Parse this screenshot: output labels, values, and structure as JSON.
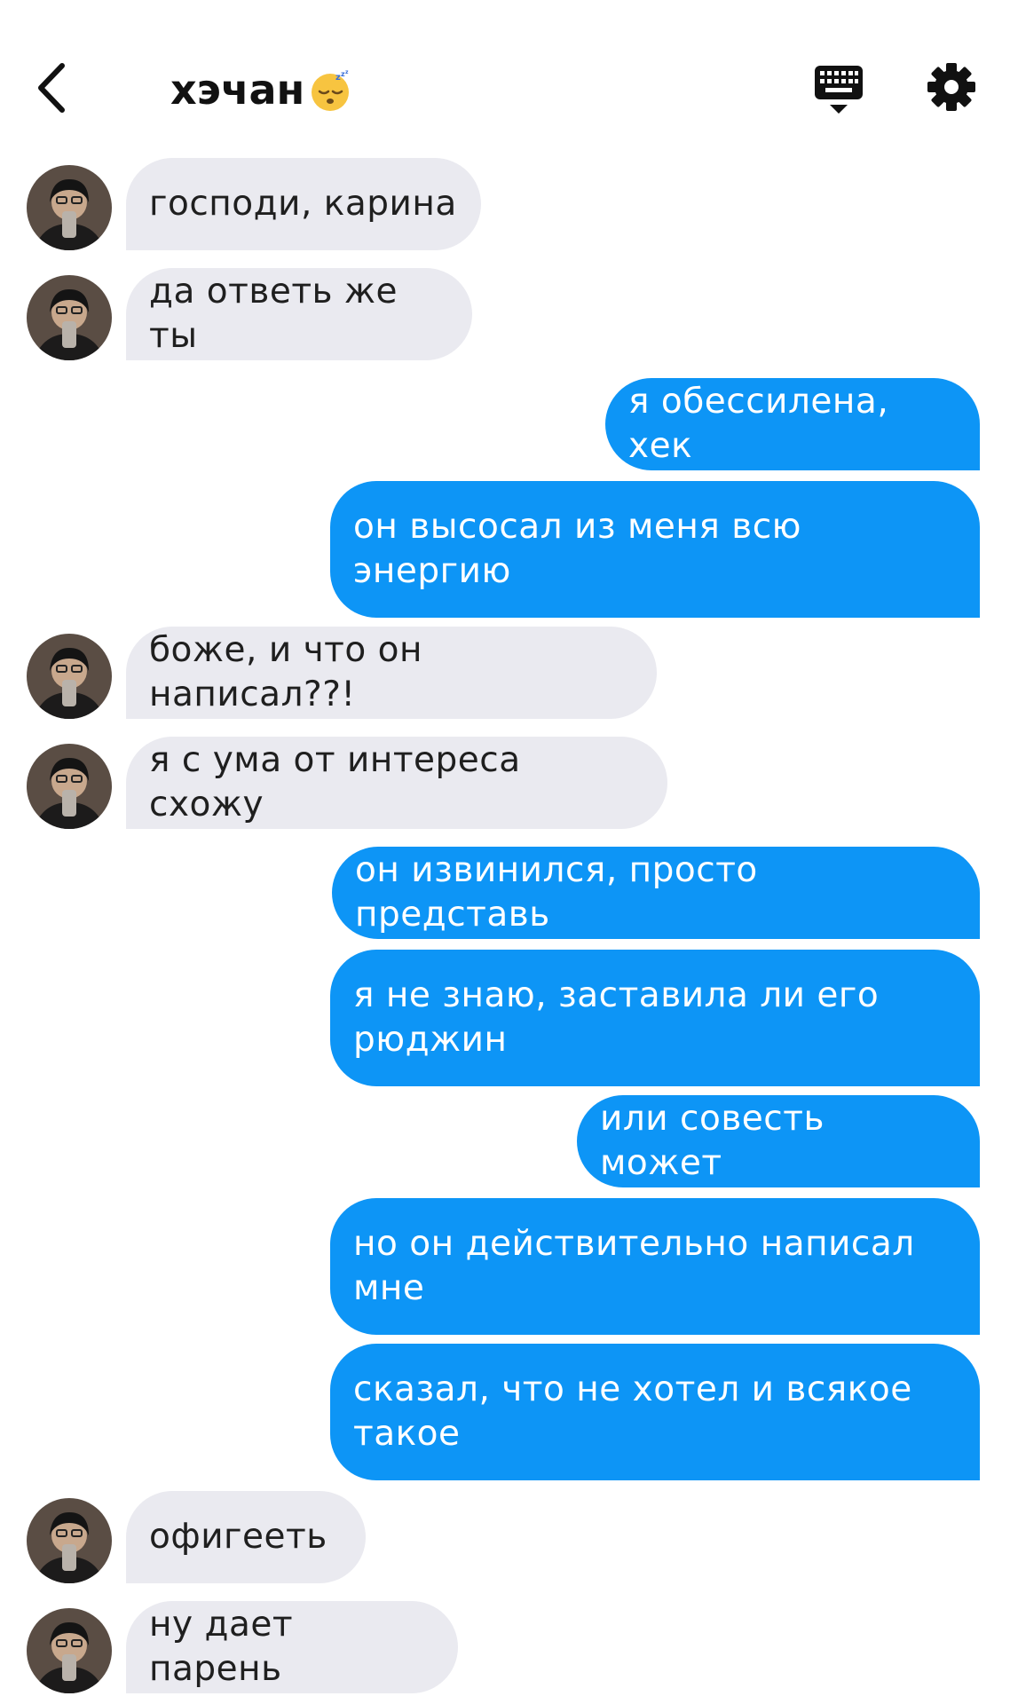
{
  "header": {
    "title": "хэчан",
    "status_emoji": "sleeping-face-emoji",
    "back_icon": "chevron-left-icon",
    "keyboard_icon": "keyboard-icon",
    "settings_icon": "gear-icon"
  },
  "colors": {
    "outgoing_bubble": "#0d95f6",
    "incoming_bubble": "#eaeaf0",
    "background": "#ffffff"
  },
  "messages": [
    {
      "from": "them",
      "text": "господи, карина"
    },
    {
      "from": "them",
      "text": "да ответь же ты"
    },
    {
      "from": "me",
      "text": "я обессилена, хек"
    },
    {
      "from": "me",
      "text": "он высосал из меня всю энергию"
    },
    {
      "from": "them",
      "text": "боже, и что он написал??!"
    },
    {
      "from": "them",
      "text": "я с ума от интереса схожу"
    },
    {
      "from": "me",
      "text": "он извинился, просто представь"
    },
    {
      "from": "me",
      "text": "я не знаю, заставила ли его рюджин"
    },
    {
      "from": "me",
      "text": "или совесть может"
    },
    {
      "from": "me",
      "text": "но он действительно написал мне"
    },
    {
      "from": "me",
      "text": "сказал, что не хотел и всякое такое"
    },
    {
      "from": "them",
      "text": "офигееть"
    },
    {
      "from": "them",
      "text": "ну дает парень"
    }
  ]
}
